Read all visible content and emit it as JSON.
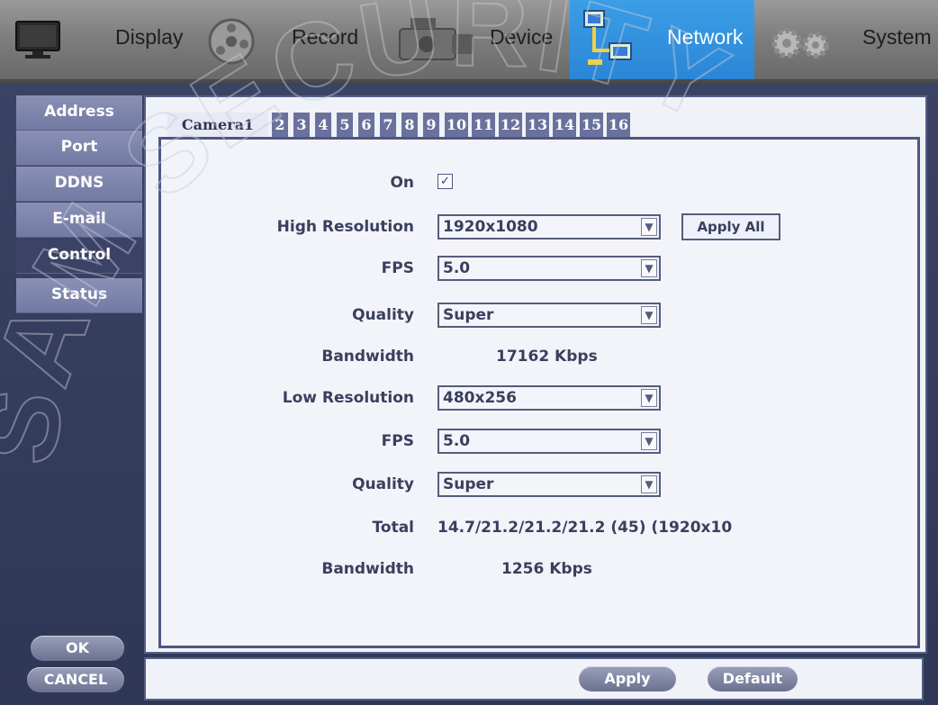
{
  "top_menu": {
    "display": "Display",
    "record": "Record",
    "device": "Device",
    "network": "Network",
    "system": "System"
  },
  "sidebar": {
    "items": [
      "Address",
      "Port",
      "DDNS",
      "E-mail",
      "Control",
      "Status"
    ],
    "active": "Control"
  },
  "tabs": {
    "first": "Camera1",
    "others": [
      "2",
      "3",
      "4",
      "5",
      "6",
      "7",
      "8",
      "9",
      "10",
      "11",
      "12",
      "13",
      "14",
      "15",
      "16"
    ]
  },
  "form": {
    "on_label": "On",
    "on_checked": "✓",
    "high_res_label": "High Resolution",
    "high_res_value": "1920x1080",
    "apply_all": "Apply All",
    "fps1_label": "FPS",
    "fps1_value": "5.0",
    "quality1_label": "Quality",
    "quality1_value": "Super",
    "bandwidth1_label": "Bandwidth",
    "bandwidth1_value": "17162 Kbps",
    "low_res_label": "Low Resolution",
    "low_res_value": "480x256",
    "fps2_label": "FPS",
    "fps2_value": "5.0",
    "quality2_label": "Quality",
    "quality2_value": "Super",
    "total_label": "Total",
    "total_value": "14.7/21.2/21.2/21.2 (45) (1920x10",
    "bandwidth2_label": "Bandwidth",
    "bandwidth2_value": "1256 Kbps"
  },
  "buttons": {
    "ok": "OK",
    "cancel": "CANCEL",
    "apply": "Apply",
    "default": "Default"
  },
  "watermark": "SAM SECURITY",
  "colors": {
    "accent": "#2b86d6",
    "panel_dark": "#3b4364",
    "sidebar": "#7a80a8"
  }
}
